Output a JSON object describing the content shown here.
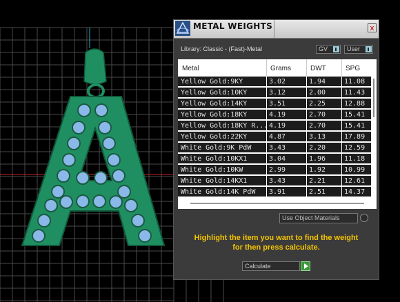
{
  "panel": {
    "title": "METAL WEIGHTS",
    "close_label": "x",
    "library": "Library: Classic - (Fast)-Metal",
    "dropdowns": {
      "gv": "GV",
      "user": "User"
    },
    "columns": [
      "Metal",
      "Grams",
      "DWT",
      "SPG"
    ],
    "rows": [
      [
        "Yellow Gold:9KY",
        "3.02",
        "1.94",
        "11.08"
      ],
      [
        "Yellow Gold:10KY",
        "3.12",
        "2.00",
        "11.43"
      ],
      [
        "Yellow Gold:14KY",
        "3.51",
        "2.25",
        "12.88"
      ],
      [
        "Yellow Gold:18KY",
        "4.19",
        "2.70",
        "15.41"
      ],
      [
        "Yellow Gold:18KY R...",
        "4.19",
        "2.70",
        "15.41"
      ],
      [
        "Yellow Gold:22KY",
        "4.87",
        "3.13",
        "17.89"
      ],
      [
        "White Gold:9K PdW",
        "3.43",
        "2.20",
        "12.59"
      ],
      [
        "White Gold:10KX1",
        "3.04",
        "1.96",
        "11.18"
      ],
      [
        "White Gold:10KW",
        "2.99",
        "1.92",
        "10.99"
      ],
      [
        "White Gold:14KX1",
        "3.43",
        "2.21",
        "12.61"
      ],
      [
        "White Gold:14K PdW",
        "3.91",
        "2.51",
        "14.37"
      ]
    ],
    "use_object_materials": "Use Object Materials",
    "hint_line1": "Highlight the item you want to find the weight",
    "hint_line2": "for then press calculate.",
    "calculate_label": "Calculate"
  },
  "colors": {
    "pendant": "#1f8f62",
    "gem": "#8ab8e8",
    "hint": "#f5c400",
    "grid": "#4a4a4a"
  }
}
